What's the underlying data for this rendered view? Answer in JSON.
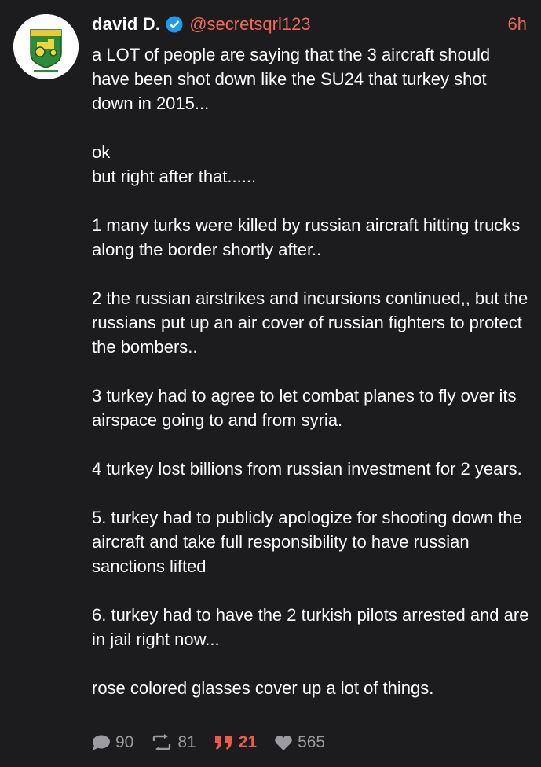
{
  "author": {
    "name": "david D.",
    "handle": "@secretsqrl123",
    "time": "6h",
    "verified": true,
    "avatar": "tractor-logo-avatar"
  },
  "post": {
    "lines": [
      "a LOT of people are saying that the 3 aircraft should have been shot down like the SU24 that turkey shot down in 2015...",
      "",
      "ok",
      "but right after that......",
      "",
      "1 many turks were killed by russian aircraft hitting trucks along the border shortly after..",
      "",
      "2 the russian airstrikes and incursions continued,, but the russians put up an air cover of russian fighters to protect the bombers..",
      "",
      "3 turkey had to agree to let combat planes to fly over its airspace going to and from syria.",
      "",
      "4 turkey lost billions from russian investment for 2 years.",
      "",
      "5. turkey had to publicly apologize for shooting down the aircraft and take full responsibility to have russian sanctions lifted",
      "",
      "6. turkey had to have the 2 turkish pilots arrested and are in jail right now...",
      "",
      "rose colored glasses cover up a lot of things."
    ]
  },
  "stats": {
    "replies": "90",
    "reposts": "81",
    "quotes": "21",
    "likes": "565"
  },
  "colors": {
    "background": "#1c1c1e",
    "accent": "#ef6a5b",
    "verified": "#1d9bf0",
    "muted": "#9c9ca0"
  }
}
